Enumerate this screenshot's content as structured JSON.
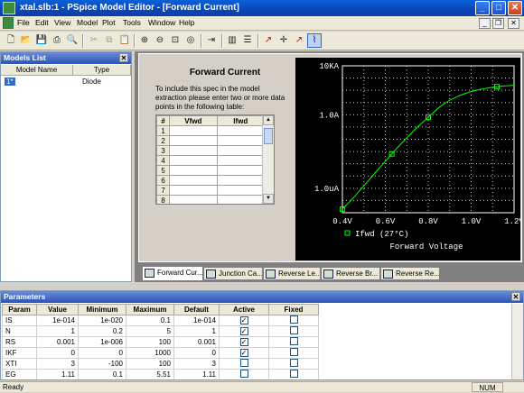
{
  "window": {
    "title": "xtal.slb:1 - PSpice Model Editor - [Forward Current]"
  },
  "menu": [
    "File",
    "Edit",
    "View",
    "Model",
    "Plot",
    "Tools",
    "Window",
    "Help"
  ],
  "models_list": {
    "title": "Models List",
    "columns": [
      "Model Name",
      "Type"
    ],
    "rows": [
      {
        "name": "1*",
        "type": "Diode"
      }
    ]
  },
  "spec": {
    "title": "Forward Current",
    "description": "To include this spec in the model extraction please enter two or more data points in the following table:",
    "columns": [
      "#",
      "Vfwd",
      "Ifwd"
    ],
    "row_numbers": [
      "1",
      "2",
      "3",
      "4",
      "5",
      "6",
      "7",
      "8"
    ]
  },
  "chart_data": {
    "type": "scatter",
    "title": "",
    "xlabel": "Forward Voltage",
    "ylabel": "",
    "x_ticks": [
      "0.4V",
      "0.6V",
      "0.8V",
      "1.0V",
      "1.2V"
    ],
    "y_ticks": [
      "10KA",
      "1.0A",
      "1.0uA"
    ],
    "xlim": [
      0.4,
      1.2
    ],
    "y_log": true,
    "ylim_exp": [
      -8,
      4
    ],
    "legend": "Ifwd (27°C)",
    "grid": true,
    "series": [
      {
        "name": "Ifwd (27°C)",
        "color": "#00ff00",
        "x": [
          0.4,
          0.45,
          0.5,
          0.55,
          0.6,
          0.65,
          0.7,
          0.75,
          0.8,
          0.85,
          0.9,
          0.95,
          1.0,
          1.05,
          1.1,
          1.15,
          1.2
        ],
        "y_exp": [
          -7.7,
          -6.8,
          -5.8,
          -4.8,
          -3.8,
          -2.8,
          -1.9,
          -1.0,
          -0.2,
          0.6,
          1.2,
          1.6,
          1.9,
          2.1,
          2.25,
          2.35,
          2.4
        ],
        "markers_x": [
          0.4,
          0.63,
          0.8,
          1.12
        ]
      }
    ]
  },
  "tabs": [
    "Forward Cur...",
    "Junction Ca...",
    "Reverse Le...",
    "Reverse Br...",
    "Reverse Re..."
  ],
  "parameters": {
    "title": "Parameters",
    "columns": [
      "Param",
      "Value",
      "Minimum",
      "Maximum",
      "Default",
      "Active",
      "Fixed"
    ],
    "rows": [
      {
        "param": "IS",
        "value": "1e-014",
        "min": "1e-020",
        "max": "0.1",
        "def": "1e-014",
        "active": true,
        "fixed": false
      },
      {
        "param": "N",
        "value": "1",
        "min": "0.2",
        "max": "5",
        "def": "1",
        "active": true,
        "fixed": false
      },
      {
        "param": "RS",
        "value": "0.001",
        "min": "1e-006",
        "max": "100",
        "def": "0.001",
        "active": true,
        "fixed": false
      },
      {
        "param": "IKF",
        "value": "0",
        "min": "0",
        "max": "1000",
        "def": "0",
        "active": true,
        "fixed": false
      },
      {
        "param": "XTI",
        "value": "3",
        "min": "-100",
        "max": "100",
        "def": "3",
        "active": false,
        "fixed": false
      },
      {
        "param": "EG",
        "value": "1.11",
        "min": "0.1",
        "max": "5.51",
        "def": "1.11",
        "active": false,
        "fixed": false
      }
    ]
  },
  "status": {
    "left": "Ready",
    "right": "NUM"
  }
}
